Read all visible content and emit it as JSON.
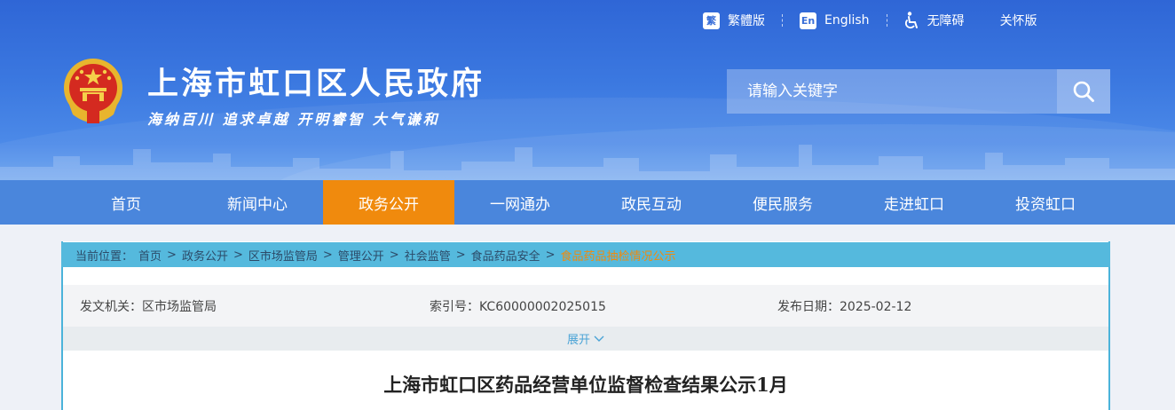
{
  "topbar": {
    "traditional": {
      "icon": "traditional-chinese-icon",
      "icon_text": "繁",
      "label": "繁體版"
    },
    "english": {
      "icon": "english-icon",
      "icon_text": "En",
      "label": "English"
    },
    "accessibility": {
      "icon": "wheelchair-icon",
      "label": "无障碍"
    },
    "care": {
      "label": "关怀版"
    }
  },
  "header": {
    "site_title": "上海市虹口区人民政府",
    "slogan": "海纳百川  追求卓越  开明睿智  大气谦和",
    "emblem": "national-emblem"
  },
  "search": {
    "placeholder": "请输入关键字",
    "icon": "search-icon"
  },
  "nav": {
    "items": [
      {
        "label": "首页"
      },
      {
        "label": "新闻中心"
      },
      {
        "label": "政务公开"
      },
      {
        "label": "一网通办"
      },
      {
        "label": "政民互动"
      },
      {
        "label": "便民服务"
      },
      {
        "label": "走进虹口"
      },
      {
        "label": "投资虹口"
      }
    ],
    "active_index": 2
  },
  "breadcrumb": {
    "prefix": "当前位置：",
    "items": [
      "首页",
      "政务公开",
      "区市场监管局",
      "管理公开",
      "社会监管",
      "食品药品安全"
    ],
    "current": "食品药品抽检情况公示",
    "separator": ">"
  },
  "meta": {
    "issuer": "发文机关：区市场监管局",
    "index_no": "索引号：KC60000002025015",
    "date": "发布日期：2025-02-12"
  },
  "expand": {
    "label": "展开",
    "icon": "chevron-down-icon"
  },
  "document": {
    "title": "上海市虹口区药品经营单位监督检查结果公示1月"
  },
  "colors": {
    "header_blue": "#3b78e0",
    "nav_blue": "#4a86dc",
    "nav_active": "#f08a0d",
    "breadcrumb_bg": "#55b9dd",
    "breadcrumb_current": "#f08a0d"
  }
}
